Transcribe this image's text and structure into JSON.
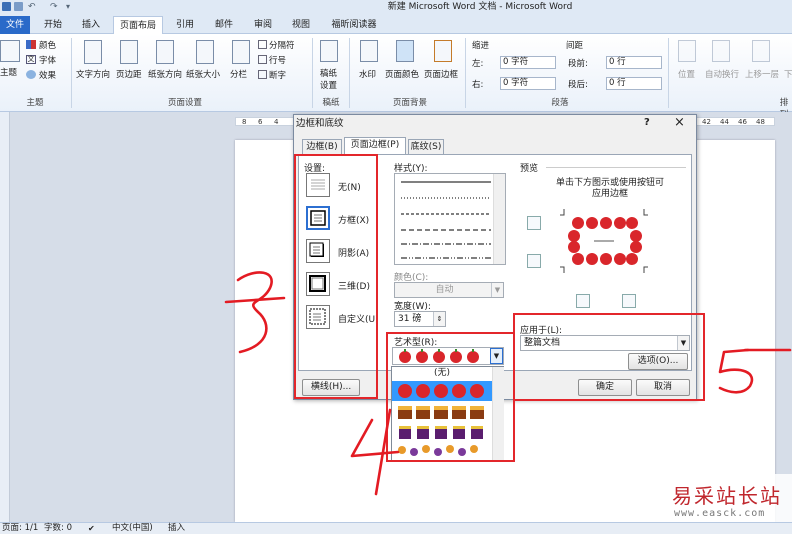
{
  "window": {
    "title": "新建 Microsoft Word 文档 - Microsoft Word"
  },
  "tabs": [
    {
      "label": "文件"
    },
    {
      "label": "开始"
    },
    {
      "label": "插入"
    },
    {
      "label": "页面布局"
    },
    {
      "label": "引用"
    },
    {
      "label": "邮件"
    },
    {
      "label": "审阅"
    },
    {
      "label": "视图"
    },
    {
      "label": "福昕阅读器"
    }
  ],
  "ribbon": {
    "theme": {
      "theme_label": "主题",
      "colors": "颜色",
      "fonts": "字体",
      "effects": "效果",
      "group": "主题"
    },
    "page_setup": {
      "text_direction": "文字方向",
      "margins": "页边距",
      "orientation": "纸张方向",
      "size": "纸张大小",
      "columns": "分栏",
      "breaks": "分隔符",
      "line_numbers": "行号",
      "hyphenation": "断字",
      "group": "页面设置"
    },
    "draft": {
      "label_line1": "稿纸",
      "label_line2": "设置",
      "group": "稿纸"
    },
    "page_bg": {
      "watermark": "水印",
      "page_color": "页面颜色",
      "page_borders": "页面边框",
      "group": "页面背景"
    },
    "paragraph": {
      "indent": "缩进",
      "spacing": "间距",
      "left_label": "左:",
      "left_value": "0 字符",
      "right_label": "右:",
      "right_value": "0 字符",
      "before_label": "段前:",
      "before_value": "0 行",
      "after_label": "段后:",
      "after_value": "0 行",
      "group": "段落"
    },
    "arrange": {
      "position": "位置",
      "wrap": "自动换行",
      "bring_forward": "上移一层",
      "send_back": "下",
      "group": "排列"
    }
  },
  "ruler": {
    "ticks_left": [
      "8",
      "6",
      "4"
    ],
    "ticks_right": [
      "42",
      "44",
      "46",
      "48"
    ]
  },
  "dialog": {
    "title": "边框和底纹",
    "help": "?",
    "close": "×",
    "tabs": [
      "边框(B)",
      "页面边框(P)",
      "底纹(S)"
    ],
    "settings_label": "设置:",
    "settings": [
      "无(N)",
      "方框(X)",
      "阴影(A)",
      "三维(D)",
      "自定义(U)"
    ],
    "style_label": "样式(Y):",
    "color_label": "颜色(C):",
    "color_value": "自动",
    "width_label": "宽度(W):",
    "width_value": "31 磅",
    "art_label": "艺术型(R):",
    "art_none": "(无)",
    "preview_label": "预览",
    "preview_hint_line1": "单击下方图示或使用按钮可",
    "preview_hint_line2": "应用边框",
    "apply_label": "应用于(L):",
    "apply_value": "整篇文档",
    "options_button": "选项(O)...",
    "horizontal_line_button": "横线(H)...",
    "ok_button": "确定",
    "cancel_button": "取消"
  },
  "status": {
    "page": "页面: 1/1",
    "words": "字数: 0",
    "language": "中文(中国)",
    "mode": "插入"
  },
  "watermark": {
    "name": "易采站长站",
    "url": "www.easck.com"
  },
  "colors": {
    "file_tab": "#2a6ac9",
    "annotation_red": "#e3262b",
    "art_red": "#d9262b"
  }
}
